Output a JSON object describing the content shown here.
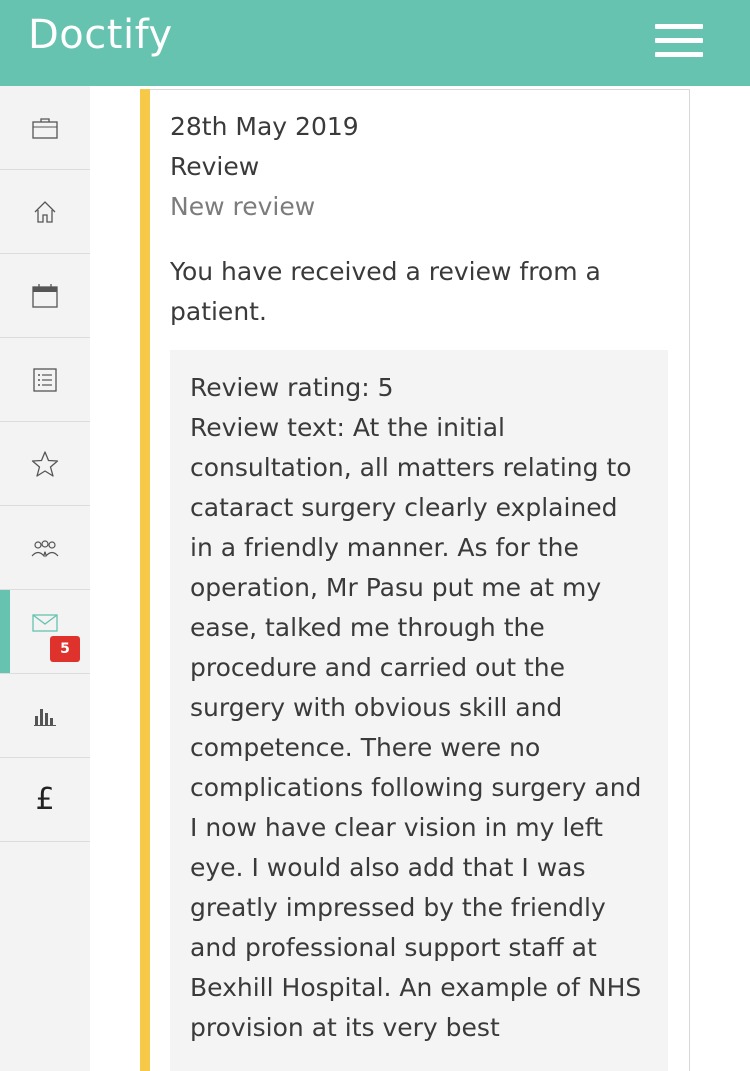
{
  "header": {
    "logo_text": "Doctify",
    "menu_icon": "hamburger-icon",
    "background_color": "#65c3b0"
  },
  "sidebar": {
    "items": [
      {
        "icon": "briefcase-icon"
      },
      {
        "icon": "home-icon"
      },
      {
        "icon": "calendar-icon"
      },
      {
        "icon": "list-icon"
      },
      {
        "icon": "star-icon"
      },
      {
        "icon": "people-icon"
      },
      {
        "icon": "mail-icon",
        "active": true,
        "badge": "5"
      },
      {
        "icon": "bar-chart-icon"
      },
      {
        "icon": "pound-icon",
        "label": "£"
      }
    ],
    "active_color": "#65c3b0",
    "badge_color": "#e0322d"
  },
  "notification": {
    "date": "28th May 2019",
    "type": "Review",
    "subtype": "New review",
    "message": "You have received a review from a patient.",
    "accent_color": "#f7c948",
    "review": {
      "rating_line": "Review rating: 5",
      "text_line": "Review text: At the initial consultation, all matters relating to cataract surgery clearly explained in a friendly manner. As for the operation, Mr Pasu put me at my ease, talked me through the procedure and carried out the surgery with obvious skill and competence. There were no complications following surgery and I now have clear vision in my left eye. I would also add that I was greatly impressed by the friendly and professional support staff at Bexhill Hospital. An example of NHS provision at its very best"
    }
  }
}
